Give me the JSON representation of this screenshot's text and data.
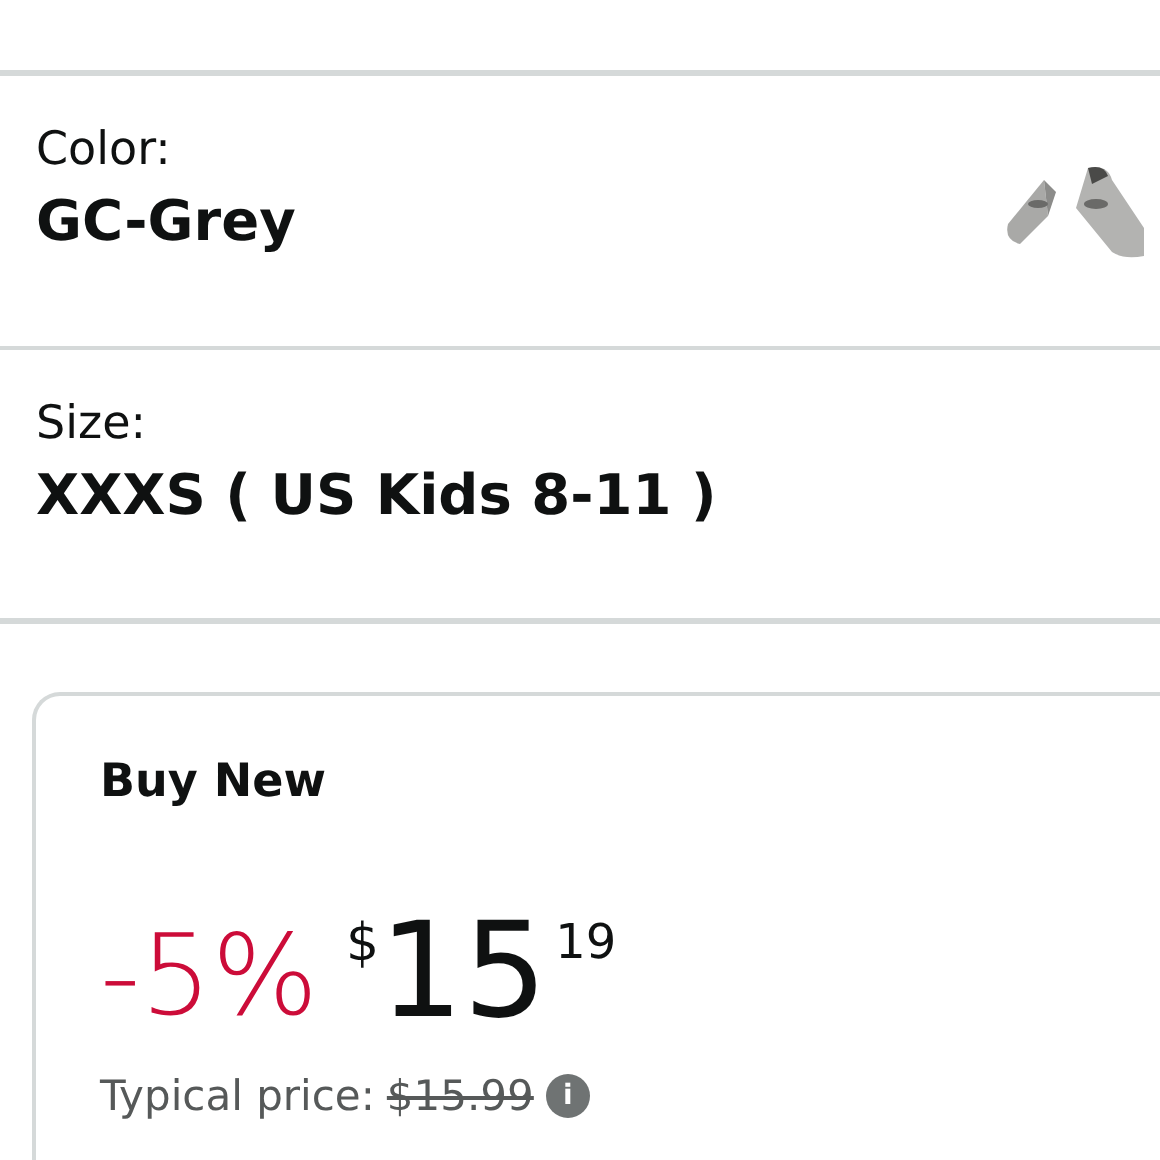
{
  "options": [
    {
      "label": "Color:",
      "value": "GC-Grey"
    },
    {
      "label": "Size:",
      "value": "XXXS ( US Kids 8-11 )"
    }
  ],
  "buy_box": {
    "title": "Buy New",
    "discount": "-5%",
    "currency": "$",
    "price_whole": "15",
    "price_fraction": "19",
    "typical_label": "Typical price:",
    "typical_price": "$15.99",
    "info_icon": "i"
  }
}
